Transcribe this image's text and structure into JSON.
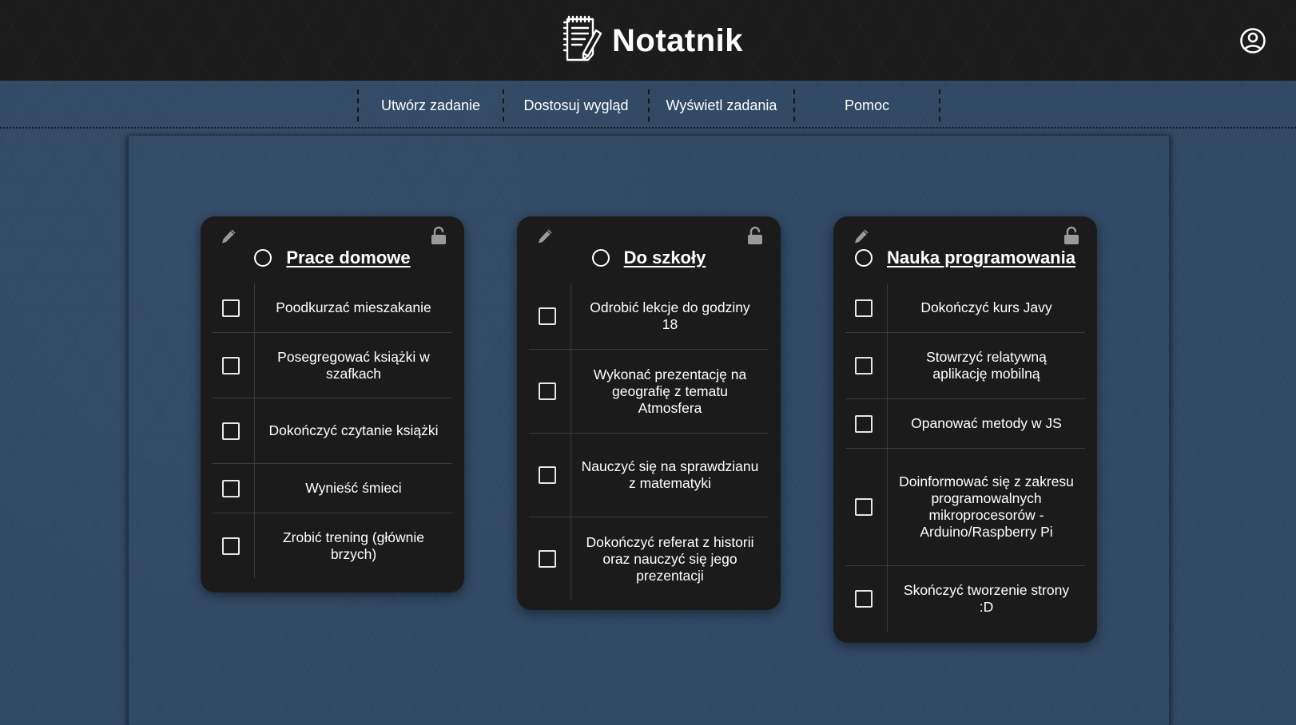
{
  "header": {
    "title": "Notatnik",
    "logo_icon": "notepad-icon",
    "user_icon": "user-circle-icon"
  },
  "nav": {
    "items": [
      {
        "label": "Utwórz zadanie"
      },
      {
        "label": "Dostosuj wygląd"
      },
      {
        "label": "Wyświetl zadania"
      },
      {
        "label": "Pomoc"
      }
    ]
  },
  "colors": {
    "page_background": "#324a66",
    "header_background": "#1c1c1c",
    "card_background": "#1b1b1b",
    "text": "#ffffff"
  },
  "lists": [
    {
      "title": "Prace domowe",
      "edit_icon": "pencil-icon",
      "lock_icon": "unlocked-padlock-icon",
      "tasks": [
        {
          "text": "Poodkurzać mieszakanie",
          "done": false
        },
        {
          "text": "Posegregować książki w szafkach",
          "done": false
        },
        {
          "text": "Dokończyć czytanie książki",
          "done": false
        },
        {
          "text": "Wynieść śmieci",
          "done": false
        },
        {
          "text": "Zrobić trening (głównie brzych)",
          "done": false
        }
      ]
    },
    {
      "title": "Do szkoły",
      "edit_icon": "pencil-icon",
      "lock_icon": "unlocked-padlock-icon",
      "tasks": [
        {
          "text": "Odrobić lekcje do godziny 18",
          "done": false
        },
        {
          "text": "Wykonać prezentację na geografię z tematu Atmosfera",
          "done": false
        },
        {
          "text": "Nauczyć się na sprawdzianu z matematyki",
          "done": false
        },
        {
          "text": "Dokończyć referat z historii oraz nauczyć się jego prezentacji",
          "done": false
        }
      ]
    },
    {
      "title": "Nauka programowania",
      "edit_icon": "pencil-icon",
      "lock_icon": "unlocked-padlock-icon",
      "tasks": [
        {
          "text": "Dokończyć kurs Javy",
          "done": false
        },
        {
          "text": "Stowrzyć relatywną aplikację mobilną",
          "done": false
        },
        {
          "text": "Opanować metody w JS",
          "done": false
        },
        {
          "text": "Doinformować się z zakresu programowalnych mikroprocesorów - Arduino/Raspberry Pi",
          "done": false
        },
        {
          "text": "Skończyć tworzenie strony :D",
          "done": false
        }
      ]
    }
  ]
}
